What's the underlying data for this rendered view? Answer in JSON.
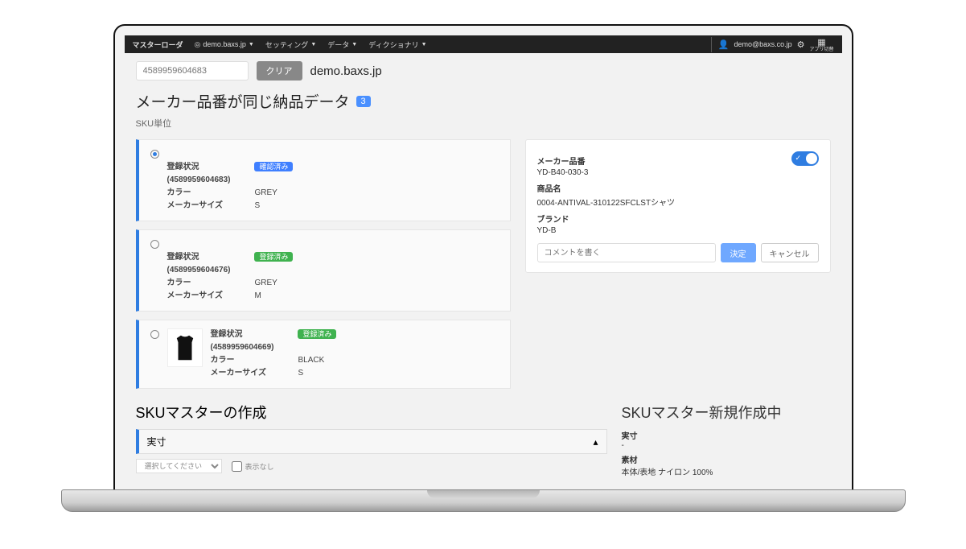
{
  "topbar": {
    "brand": "マスターローダ",
    "host_icon": "◎",
    "host": "demo.baxs.jp",
    "menus": [
      "セッティング",
      "データ",
      "ディクショナリ"
    ],
    "user": "demo@baxs.co.jp",
    "app_switch_label": "アプリ切替"
  },
  "search": {
    "placeholder": "4589959604683",
    "clear": "クリア",
    "domain": "demo.baxs.jp"
  },
  "section": {
    "title": "メーカー品番が同じ納品データ",
    "count": "3",
    "subtitle": "SKU単位"
  },
  "sku_field_labels": {
    "status": "登録状況",
    "color": "カラー",
    "size": "メーカーサイズ"
  },
  "skus": [
    {
      "selected": true,
      "code": "(4589959604683)",
      "status_badge": "確認済み",
      "badge_kind": "blue",
      "color": "GREY",
      "size": "S",
      "has_thumb": false
    },
    {
      "selected": false,
      "code": "(4589959604676)",
      "status_badge": "登録済み",
      "badge_kind": "green",
      "color": "GREY",
      "size": "M",
      "has_thumb": false
    },
    {
      "selected": false,
      "code": "(4589959604669)",
      "status_badge": "登録済み",
      "badge_kind": "green",
      "color": "BLACK",
      "size": "S",
      "has_thumb": true
    }
  ],
  "detail": {
    "labels": {
      "maker_no": "メーカー品番",
      "name": "商品名",
      "brand": "ブランド"
    },
    "maker_no": "YD-B40-030-3",
    "name": "0004-ANTIVAL-310122SFCLSTシャツ",
    "brand": "YD-B",
    "comment_placeholder": "コメントを書く",
    "submit": "決定",
    "cancel": "キャンセル"
  },
  "bottom": {
    "create_title": "SKUマスターの作成",
    "expander_label": "実寸",
    "select_placeholder": "選択してください",
    "checkbox_label": "表示なし",
    "creating_title": "SKUマスター新規作成中",
    "spec_labels": {
      "measure": "実寸",
      "material": "素材"
    },
    "measure_value": "-",
    "material_value": "本体/表地 ナイロン 100%"
  }
}
